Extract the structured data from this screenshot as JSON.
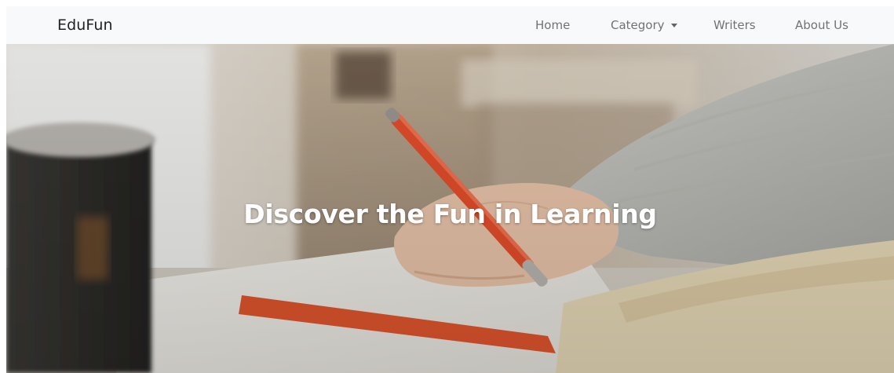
{
  "navbar": {
    "brand": "EduFun",
    "links": [
      {
        "label": "Home"
      },
      {
        "label": "Category",
        "has_dropdown": true
      },
      {
        "label": "Writers"
      },
      {
        "label": "About Us"
      }
    ],
    "background": "#f8f9fa",
    "link_color": "#6c757d"
  },
  "hero": {
    "title": "Discover the Fun in Learning",
    "title_color": "#ffffff",
    "image_description_icon": "hand-writing-notebook-image"
  }
}
